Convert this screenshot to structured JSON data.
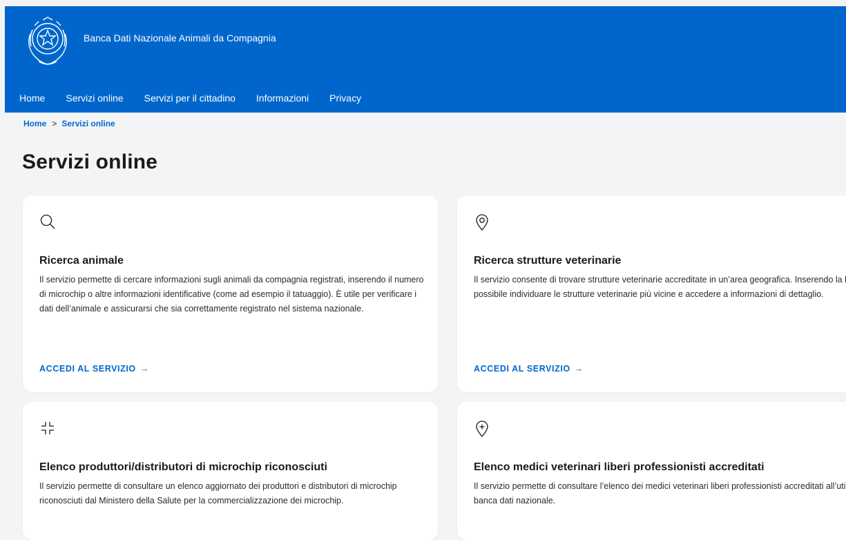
{
  "header": {
    "site_title": "Banca Dati Nazionale Animali da Compagnia",
    "nav": [
      "Home",
      "Servizi online",
      "Servizi per il cittadino",
      "Informazioni",
      "Privacy"
    ]
  },
  "breadcrumb": {
    "home": "Home",
    "separator": ">",
    "current": "Servizi online"
  },
  "page_title": "Servizi online",
  "cards": [
    {
      "icon": "search-icon",
      "title": "Ricerca animale",
      "text": "Il servizio permette di cercare informazioni sugli animali da compagnia registrati, inserendo il numero di microchip o altre informazioni identificative (come ad esempio il tatuaggio). È utile per verificare i dati dell’animale e assicurarsi che sia correttamente registrato nel sistema nazionale.",
      "link": "ACCEDI AL SERVIZIO",
      "link_arrow": "→"
    },
    {
      "icon": "map-pin-icon",
      "title": "Ricerca strutture veterinarie",
      "text": "Il servizio consente di trovare strutture veterinarie accreditate in un’area geografica. Inserendo la località, è possibile individuare le strutture veterinarie più vicine e accedere a informazioni di dettaglio.",
      "link": "ACCEDI AL SERVIZIO",
      "link_arrow": "→"
    },
    {
      "icon": "minimize-icon",
      "title": "Elenco produttori/distributori di microchip riconosciuti",
      "text": "Il servizio permette di consultare un elenco aggiornato dei produttori e distributori di microchip riconosciuti dal Ministero della Salute per la commercializzazione dei microchip."
    },
    {
      "icon": "map-pin-plus-icon",
      "title": "Elenco medici veterinari liberi professionisti accreditati",
      "text": "Il servizio permette di consultare l’elenco dei medici veterinari liberi professionisti accreditati all’utilizzo della banca dati nazionale."
    }
  ],
  "colors": {
    "brand": "#0066cc",
    "background": "#f2f4f6",
    "card": "#ffffff"
  }
}
